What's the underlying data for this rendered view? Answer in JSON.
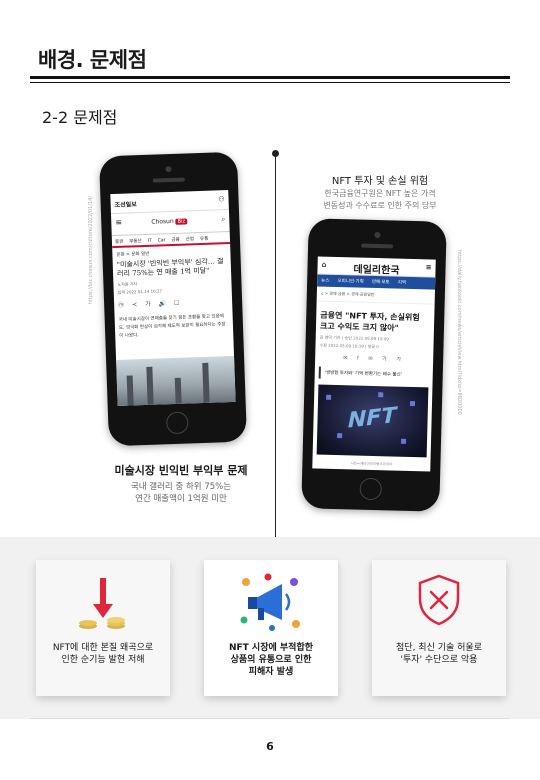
{
  "header": {
    "title": "배경. 문제점",
    "subtitle": "2-2 문제점"
  },
  "left_article": {
    "site_logo": "조선일보",
    "brand": "Chosun",
    "brand_badge": "Biz",
    "menu": [
      "증권",
      "부동산",
      "IT",
      "Car",
      "금융",
      "산업",
      "유통"
    ],
    "breadcrumb": "문화 > 문화 일반",
    "headline": "\"미술시장 '빈익빈 부익부' 심각… 갤러리 75%는 연 매출 1억 미달\"",
    "byline": "노자용 기자",
    "date": "입력 2022.01.14 10:27",
    "icons": "ⓜ ≺ 가 🔊 ☐",
    "body": "국내 미술시장이 연매출을 찾기 힘든 초황을 맞고 있음에도, 양극화 현상이 심각해 제도적 보완이 필요하다는 주장이 나왔다.",
    "source_vertical": "https://biz.chosun.com/culture/2022/01/14/",
    "caption_title": "미술시장 빈익빈 부익부 문제",
    "caption_sub_1": "국내 갤러리 중 하위 75%는",
    "caption_sub_2": "연간 매출액이 1억원 미만"
  },
  "right_article": {
    "caption_title": "NFT 투자 및 손실 위험",
    "caption_sub_1": "한국금융연구원은 NFT 높은 가격",
    "caption_sub_2": "변동성과 수수료로 인한 주의 당부",
    "site_logo": "데일리한국",
    "menu": [
      "뉴스",
      "오피니언·기획",
      "연예·포토",
      "지역"
    ],
    "breadcrumb": "⌂ > 경제·금융 > 경제·금융일반",
    "headline_1": "금융연 \"NFT 투자, 손실위험",
    "headline_2": "크고 수익도 크지 않아\"",
    "meta_1": "김 영덕 기자 | 승인 2022.05.09 10:09",
    "meta_2": "수정 2022.05.09 10:19 | 댓글 0",
    "icons": "✉ f ✉ 가 가",
    "quote": "'쌍방향 투자와' 기억 변환기는 배수 불신'",
    "image_text": "NFT",
    "footer": "사진=게티이미지뱅크코리아",
    "source_vertical": "https://daily.hankooki.com/news/articleView.html?idxno=8820000"
  },
  "cards": [
    {
      "line1": "NFT에 대한 본질 왜곡으로",
      "line2": "인한 순기능 발현 저해",
      "line3": ""
    },
    {
      "line1": "NFT 시장에 부적합한",
      "line2": "상품의 유통으로 인한",
      "line3": "피해자 발생"
    },
    {
      "line1": "첨단, 최신 기술 허울로",
      "line2": "'투자' 수단으로 악용",
      "line3": ""
    }
  ],
  "page_number": "6",
  "colors": {
    "accent_red": "#e0263a",
    "chosun_red": "#c8102e",
    "hankook_blue": "#1f4e9c"
  }
}
